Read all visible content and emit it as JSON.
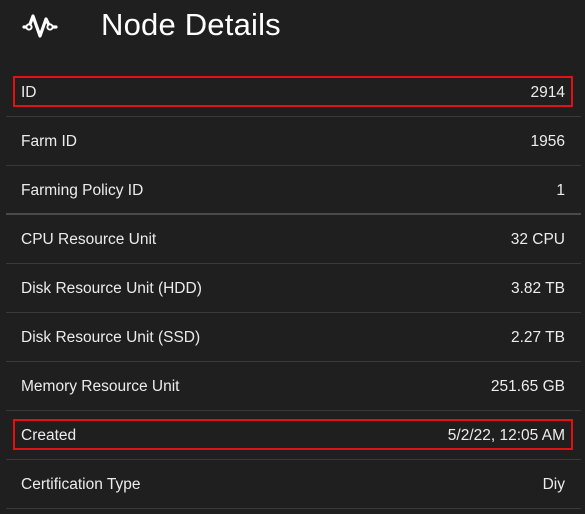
{
  "header": {
    "title": "Node Details",
    "icon": "activity-pulse-icon"
  },
  "details": [
    {
      "label": "ID",
      "value": "2914",
      "highlighted": true
    },
    {
      "label": "Farm ID",
      "value": "1956",
      "highlighted": false
    },
    {
      "label": "Farming Policy ID",
      "value": "1",
      "highlighted": false
    },
    {
      "label": "CPU Resource Unit",
      "value": "32 CPU",
      "highlighted": false
    },
    {
      "label": "Disk Resource Unit (HDD)",
      "value": "3.82 TB",
      "highlighted": false
    },
    {
      "label": "Disk Resource Unit (SSD)",
      "value": "2.27 TB",
      "highlighted": false
    },
    {
      "label": "Memory Resource Unit",
      "value": "251.65 GB",
      "highlighted": false
    },
    {
      "label": "Created",
      "value": "5/2/22, 12:05 AM",
      "highlighted": true
    },
    {
      "label": "Certification Type",
      "value": "Diy",
      "highlighted": false
    }
  ],
  "colors": {
    "background": "#1f1f1f",
    "text": "#ececec",
    "divider": "#3a3a3a",
    "highlight": "#e21212"
  }
}
